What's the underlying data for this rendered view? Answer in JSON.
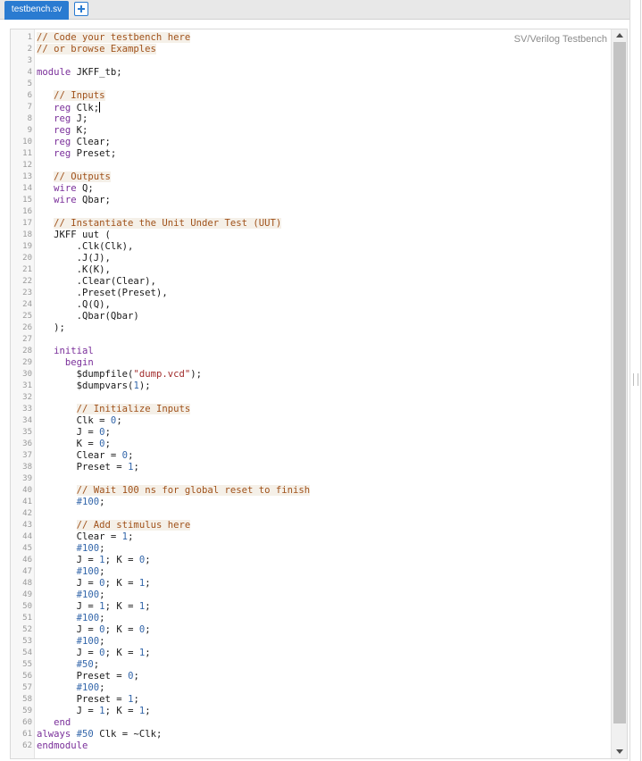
{
  "tab": {
    "label": "testbench.sv"
  },
  "editor": {
    "language_label": "SV/Verilog Testbench",
    "cursor_line": 7,
    "lines": [
      "// Code your testbench here",
      "// or browse Examples",
      "",
      "module JKFF_tb;",
      "",
      "   // Inputs",
      "   reg Clk;",
      "   reg J;",
      "   reg K;",
      "   reg Clear;",
      "   reg Preset;",
      "",
      "   // Outputs",
      "   wire Q;",
      "   wire Qbar;",
      "",
      "   // Instantiate the Unit Under Test (UUT)",
      "   JKFF uut (",
      "       .Clk(Clk),",
      "       .J(J),",
      "       .K(K),",
      "       .Clear(Clear),",
      "       .Preset(Preset),",
      "       .Q(Q),",
      "       .Qbar(Qbar)",
      "   );",
      "",
      "   initial",
      "     begin",
      "       $dumpfile(\"dump.vcd\");",
      "       $dumpvars(1);",
      "",
      "       // Initialize Inputs",
      "       Clk = 0;",
      "       J = 0;",
      "       K = 0;",
      "       Clear = 0;",
      "       Preset = 1;",
      "",
      "       // Wait 100 ns for global reset to finish",
      "       #100;",
      "",
      "       // Add stimulus here",
      "       Clear = 1;",
      "       #100;",
      "       J = 1; K = 0;",
      "       #100;",
      "       J = 0; K = 1;",
      "       #100;",
      "       J = 1; K = 1;",
      "       #100;",
      "       J = 0; K = 0;",
      "       #100;",
      "       J = 0; K = 1;",
      "       #50;",
      "       Preset = 0;",
      "       #100;",
      "       Preset = 1;",
      "       J = 1; K = 1;",
      "   end",
      "always #50 Clk = ~Clk;",
      "endmodule"
    ]
  },
  "colors": {
    "tab_accent": "#2a7bd1",
    "comment": "#a0521b",
    "keyword": "#7a2f9a",
    "number": "#3366aa",
    "string": "#a12b2b"
  }
}
